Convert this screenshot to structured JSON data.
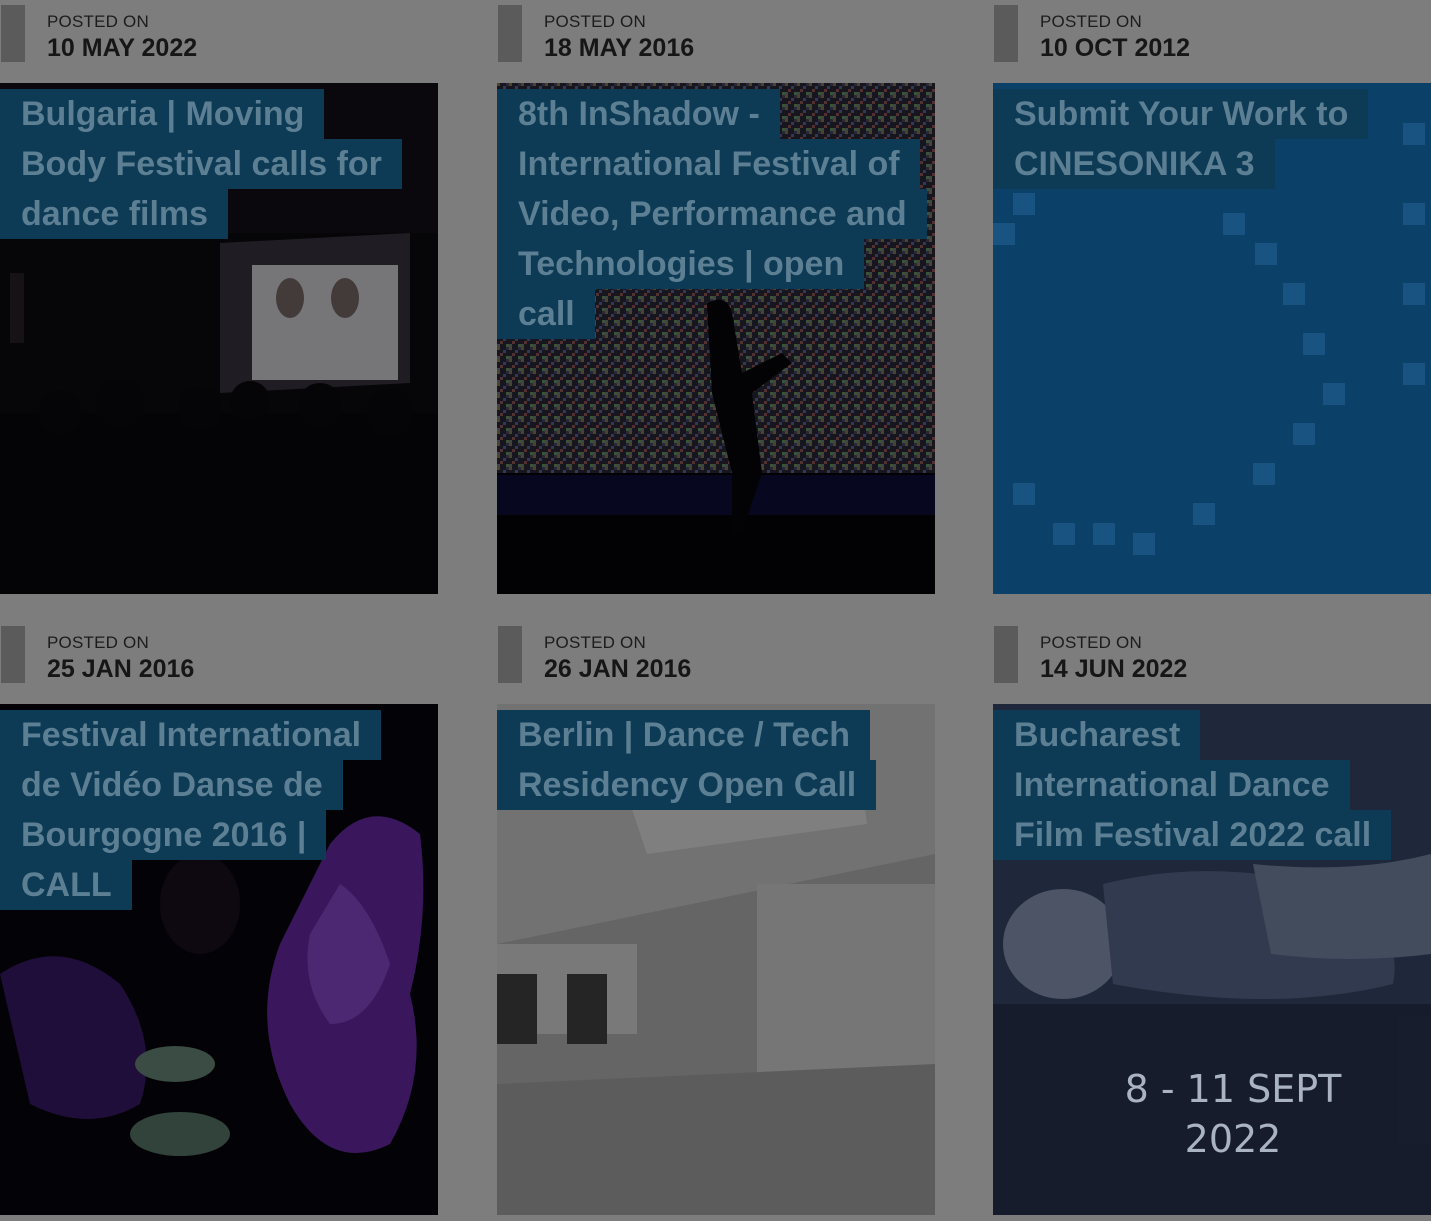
{
  "colors": {
    "page_background": "#7d7d7d",
    "title_background": "#0d3a55",
    "title_text": "#5d7f93",
    "meta_bar": "#5b5b5b"
  },
  "posts": [
    {
      "posted_label": "POSTED ON",
      "date": "10 MAY 2022",
      "title_lines": [
        "Bulgaria | Moving",
        "Body Festival calls for",
        "dance films"
      ],
      "thumbnail": "screening-room-image"
    },
    {
      "posted_label": "POSTED ON",
      "date": "18 MAY 2016",
      "title_lines": [
        "8th InShadow -",
        "International Festival of",
        "Video, Performance and",
        "Technologies | open",
        "call"
      ],
      "thumbnail": "dancer-projection-noise-image"
    },
    {
      "posted_label": "POSTED ON",
      "date": "10 OCT 2012",
      "title_lines": [
        "Submit Your Work to",
        "CINESONIKA 3"
      ],
      "thumbnail": "cinesonika-blue-pixel-image"
    },
    {
      "posted_label": "POSTED ON",
      "date": "25 JAN 2016",
      "title_lines": [
        "Festival International",
        "de Vidéo Danse de",
        "Bourgogne 2016 |",
        "CALL"
      ],
      "thumbnail": "purple-light-dancer-image"
    },
    {
      "posted_label": "POSTED ON",
      "date": "26 JAN 2016",
      "title_lines": [
        "Berlin | Dance / Tech",
        "Residency Open Call"
      ],
      "thumbnail": "empty-studio-image"
    },
    {
      "posted_label": "POSTED ON",
      "date": "14 JUN 2022",
      "title_lines": [
        "Bucharest",
        "International Dance",
        "Film Festival 2022 call"
      ],
      "thumbnail": "dancer-lying-image",
      "thumbnail_caption": [
        "8 - 11 SEPT",
        "2022"
      ]
    }
  ]
}
